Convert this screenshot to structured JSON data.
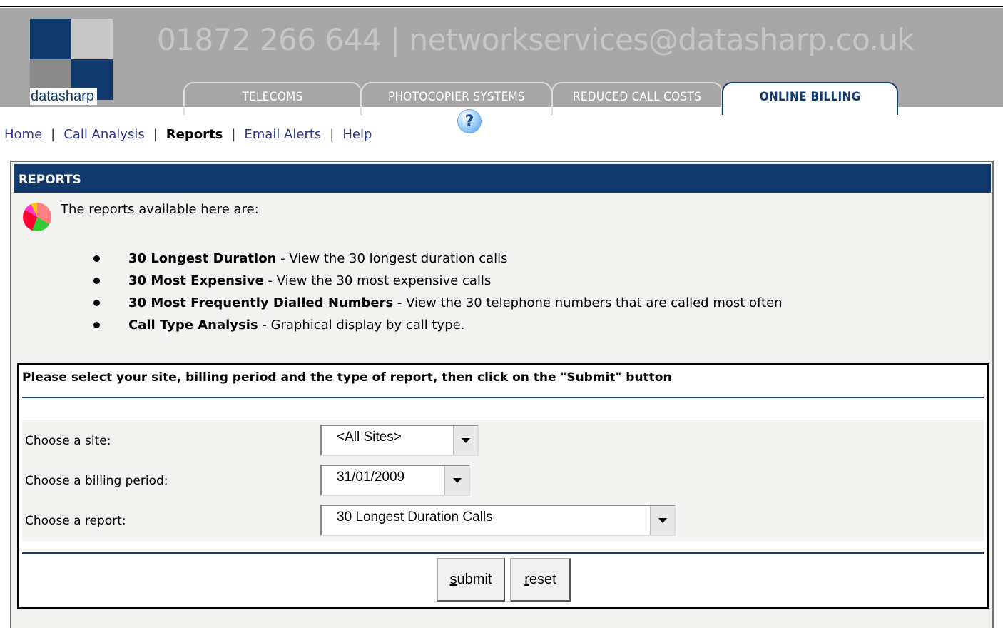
{
  "header": {
    "logo_text": "datasharp",
    "contact": "01872 266 644 | networkservices@datasharp.co.uk",
    "tabs": [
      {
        "label": "TELECOMS"
      },
      {
        "label": "PHOTOCOPIER SYSTEMS"
      },
      {
        "label": "REDUCED CALL COSTS"
      },
      {
        "label": "ONLINE BILLING",
        "active": true
      }
    ]
  },
  "nav": {
    "home": "Home",
    "call_analysis": "Call Analysis",
    "reports": "Reports",
    "email_alerts": "Email Alerts",
    "help": "Help",
    "separator": "|",
    "help_icon": "question-mark-icon"
  },
  "panel": {
    "title": "REPORTS",
    "icon": "pie-chart-icon",
    "intro": "The reports available here are:",
    "reports": [
      {
        "name": "30 Longest Duration",
        "desc": " - View the 30 longest duration calls"
      },
      {
        "name": "30 Most Expensive",
        "desc": " - View the 30 most expensive calls"
      },
      {
        "name": "30 Most Frequently Dialled Numbers",
        "desc": " - View the 30 telephone numbers that are called most often"
      },
      {
        "name": "Call Type Analysis",
        "desc": " - Graphical display by call type."
      }
    ]
  },
  "form": {
    "title": "Please select your site, billing period and the type of report, then click on the \"Submit\" button",
    "site_label": "Choose a site:",
    "site_value": "<All Sites>",
    "period_label": "Choose a billing period:",
    "period_value": "31/01/2009",
    "report_label": "Choose a report:",
    "report_value": "30 Longest Duration Calls",
    "submit_key": "s",
    "submit_rest": "ubmit",
    "reset_key": "r",
    "reset_rest": "eset"
  },
  "colors": {
    "header_bg": "#a7a7a7",
    "navy": "#11396b",
    "panel_bg": "#f2f2f0",
    "link": "#2a3a8a"
  }
}
